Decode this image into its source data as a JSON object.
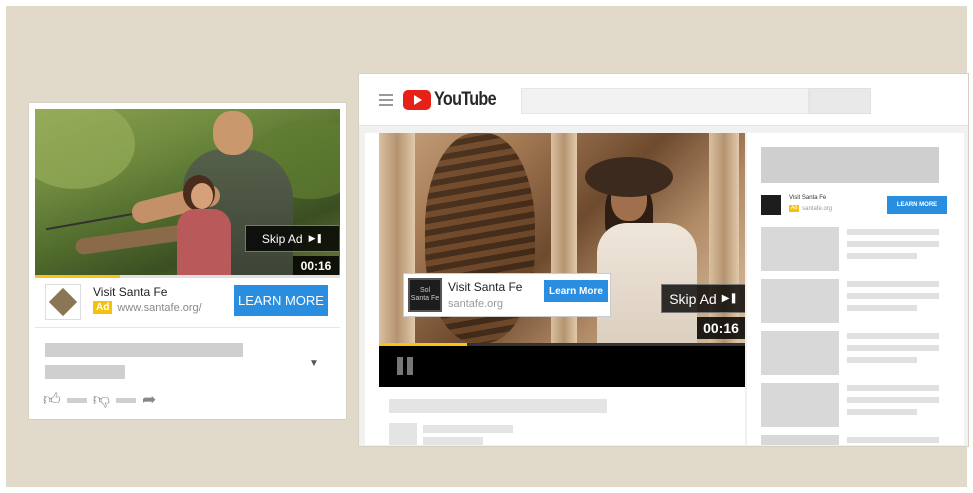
{
  "mobile": {
    "skip_ad": "Skip Ad",
    "timer": "00:16",
    "progress": 0.28,
    "advertiser": "Visit Santa Fe",
    "ad_badge": "Ad",
    "url": "www.santafe.org/",
    "cta": "LEARN MORE"
  },
  "desktop": {
    "brand": "YouTube",
    "ad_title": "Visit Santa Fe",
    "ad_url": "santafe.org",
    "cta": "Learn More",
    "skip_ad": "Skip Ad",
    "timer": "00:16",
    "progress": 0.24,
    "logo_text": "Sol Santa Fe",
    "sidebar_ad": {
      "title": "Visit Santa Fe",
      "badge": "Ad",
      "url": "santafe.org",
      "cta": "LEARN MORE"
    }
  },
  "colors": {
    "background": "#e1d9c9",
    "cta_blue": "#2a8ee0",
    "ad_yellow": "#f4c20d",
    "youtube_red": "#e62117"
  },
  "icons": {
    "skip": "skip-next-icon",
    "like": "thumbs-up-icon",
    "dislike": "thumbs-down-icon",
    "share": "share-icon",
    "menu": "hamburger-icon",
    "pause": "pause-icon",
    "chevron": "chevron-down-icon"
  }
}
